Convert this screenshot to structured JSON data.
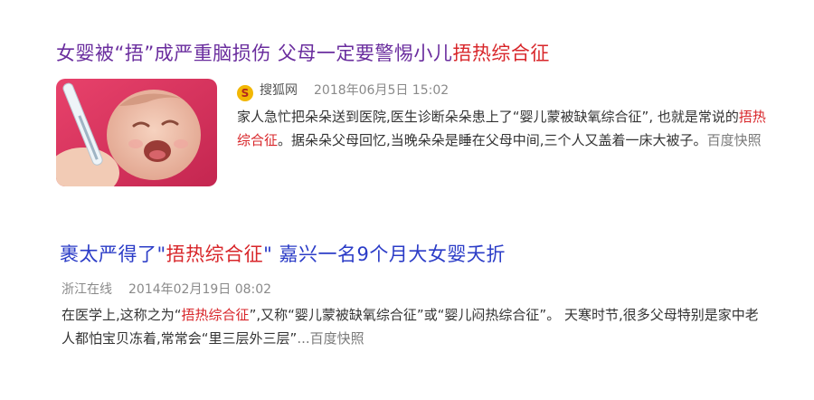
{
  "results": [
    {
      "title_pre": "女婴被“捂”成严重脑损伤 父母一定要警惕小儿",
      "title_hl": "捂热综合征",
      "title_post": "",
      "source_icon_char": "S",
      "source_icon": "sohu-fox-icon",
      "source": "搜狐网",
      "date": "2018年06月5日 15:02",
      "snippet_pre": "家人急忙把朵朵送到医院,医生诊断朵朵患上了“婴儿蒙被缺氧综合征”, 也就是常说的",
      "snippet_hl": "捂热综合征",
      "snippet_post": "。据朵朵父母回忆,当晚朵朵是睡在父母中间,三个人又盖着一床大被子。",
      "cache": "百度快照"
    },
    {
      "title_pre": "裹太严得了\"",
      "title_hl": "捂热综合征",
      "title_post": "\" 嘉兴一名9个月大女婴夭折",
      "source": "浙江在线",
      "date": "2014年02月19日 08:02",
      "snippet_pre": "在医学上,这称之为“",
      "snippet_hl": "捂热综合征",
      "snippet_post": "”,又称“婴儿蒙被缺氧综合征”或“婴儿闷热综合征”。 天寒时节,很多父母特别是家中老人都怕宝贝冻着,常常会“里三层外三层”",
      "cache": "...百度快照"
    }
  ],
  "colors": {
    "visited_title": "#6a2d9e",
    "link_title": "#2b3cc7",
    "highlight": "#d8262a",
    "meta": "#8a8a8a"
  }
}
